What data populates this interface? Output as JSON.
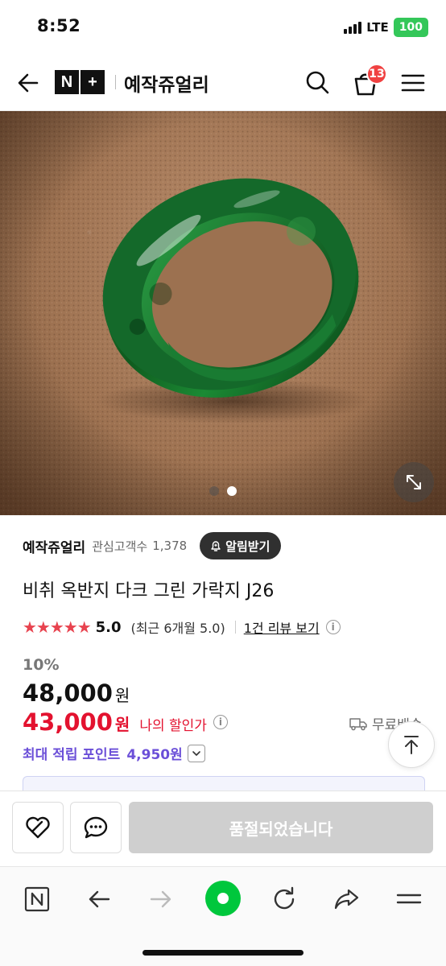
{
  "status_bar": {
    "time": "8:52",
    "network": "LTE",
    "battery": "100"
  },
  "header": {
    "logo_n": "N",
    "logo_plus": "+",
    "store_title": "예작쥬얼리",
    "cart_count": "13"
  },
  "gallery": {
    "image_count": 2,
    "active_index": 1
  },
  "store": {
    "name": "예작쥬얼리",
    "follower_label": "관심고객수",
    "follower_count": "1,378",
    "alarm_label": "알림받기"
  },
  "product": {
    "title": "비취 옥반지 다크 그린 가락지 J26",
    "rating_stars": "★★★★★",
    "rating_score": "5.0",
    "rating_recent": "(최근 6개월 5.0)",
    "review_link": "1건 리뷰 보기",
    "discount_rate": "10%",
    "original_price": "48,000",
    "sale_price": "43,000",
    "currency": "원",
    "my_price_label": "나의 할인가",
    "shipping": "무료배송",
    "points_label": "최대 적립 포인트",
    "points_value": "4,950원"
  },
  "actions": {
    "soldout_label": "품절되었습니다"
  },
  "colors": {
    "sale_red": "#e3122f",
    "points_purple": "#6b4fd8",
    "cart_badge": "#f04141",
    "star": "#e8434f",
    "browser_green": "#00c73c"
  }
}
